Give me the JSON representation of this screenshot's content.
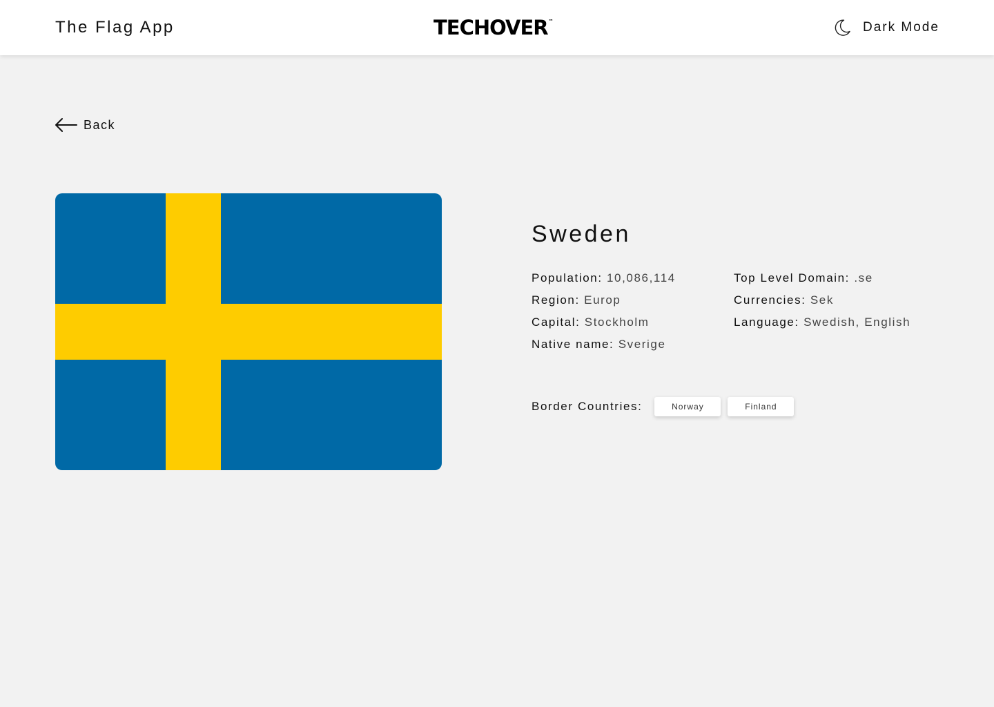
{
  "header": {
    "app_title": "The Flag App",
    "logo_text": "TECHOVER",
    "logo_tm": "™",
    "dark_mode_label": "Dark Mode",
    "dark_mode_icon": "moon-icon"
  },
  "nav": {
    "back_label": "Back",
    "back_icon": "arrow-left-icon"
  },
  "country": {
    "name": "Sweden",
    "flag_colors": {
      "blue": "#0069a6",
      "yellow": "#fecc00"
    },
    "details_left": [
      {
        "key": "Population:",
        "value": "10,086,114"
      },
      {
        "key": "Region:",
        "value": "Europ"
      },
      {
        "key": "Capital:",
        "value": "Stockholm"
      },
      {
        "key": "Native name:",
        "value": "Sverige"
      }
    ],
    "details_right": [
      {
        "key": "Top Level Domain:",
        "value": ".se"
      },
      {
        "key": "Currencies:",
        "value": "Sek"
      },
      {
        "key": "Language:",
        "value": "Swedish, English"
      }
    ],
    "border_label": "Border Countries:",
    "border_countries": [
      "Norway",
      "Finland"
    ]
  },
  "colors": {
    "page_background": "#f2f2f2",
    "header_background": "#ffffff"
  }
}
